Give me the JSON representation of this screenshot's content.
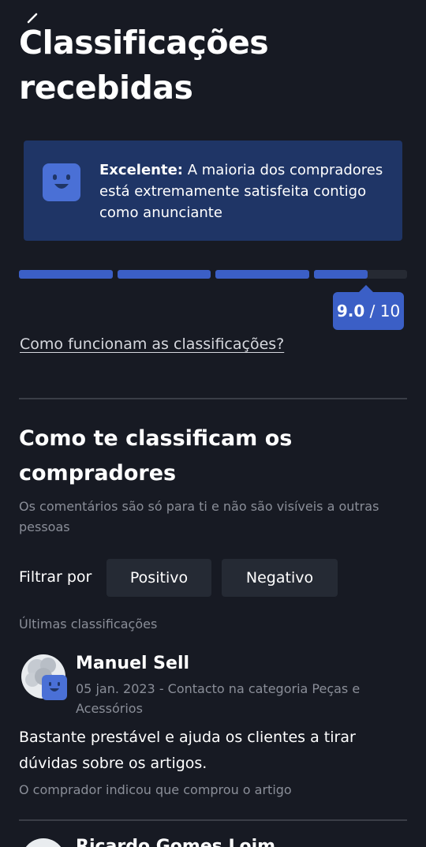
{
  "header": {
    "title": "Classificações recebidas",
    "back_icon": "back-arrow-icon"
  },
  "summary": {
    "face_icon": "happy-face-icon",
    "level": "Excelente:",
    "message": " A maioria dos compradores está extremamente satisfeita contigo como anunciante"
  },
  "score": {
    "value": "9.0",
    "max": " / 10",
    "fill_fraction": 0.9,
    "segments": 4
  },
  "how_link": "Como funcionam as classificações?",
  "ratings_section": {
    "title": "Como te classificam os compradores",
    "subtitle": "Os comentários são só para ti e não são visíveis a outras pessoas"
  },
  "filter": {
    "label": "Filtrar por",
    "options": [
      "Positivo",
      "Negativo"
    ]
  },
  "latest_label": "Últimas classificações",
  "reviews": [
    {
      "name": "Manuel Sell",
      "meta": "05 jan. 2023 - Contacto na categoria Peças e Acessórios",
      "text": "Bastante prestável e ajuda os clientes a tirar dúvidas sobre os artigos.",
      "note": "O comprador indicou que comprou o artigo"
    },
    {
      "name": "Ricardo Gomes Loim"
    }
  ],
  "colors": {
    "background": "#171a23",
    "accent": "#3b5fc6",
    "info_box": "#1f3566"
  }
}
